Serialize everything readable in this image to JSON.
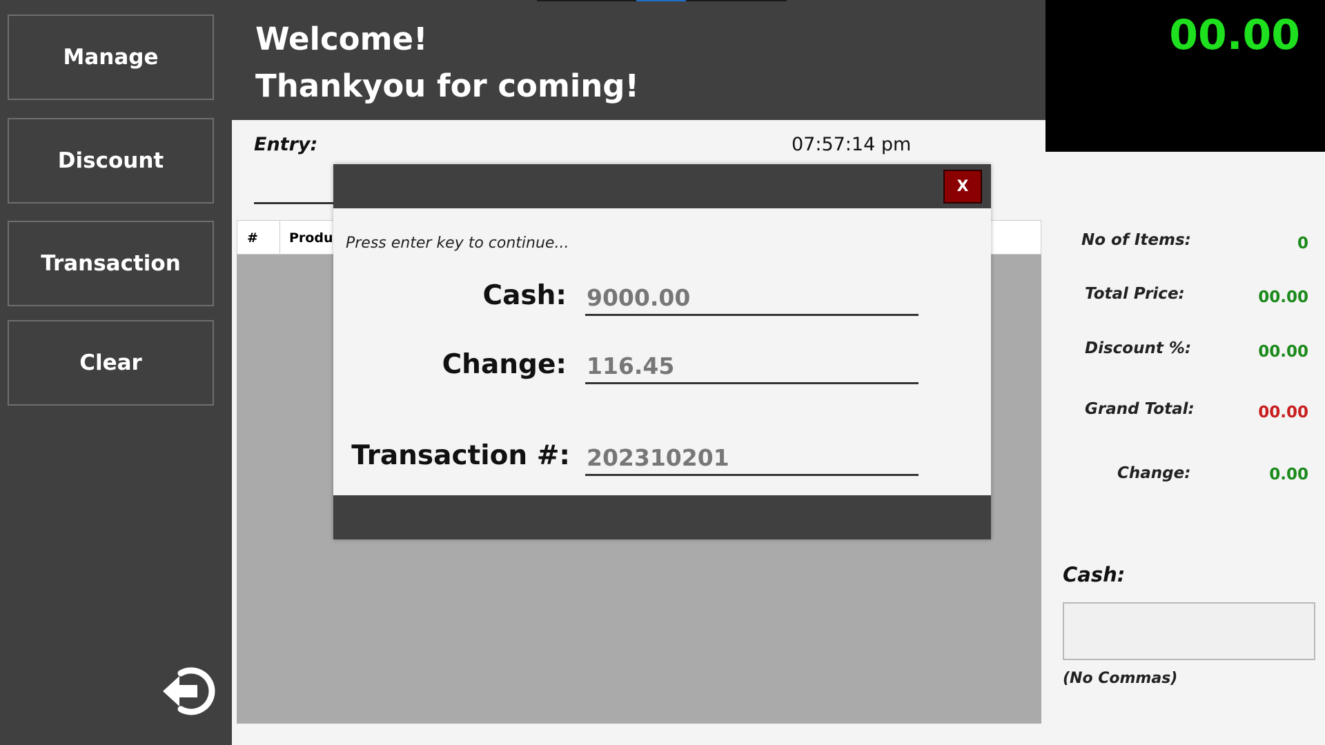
{
  "sidebar": {
    "buttons": [
      {
        "label": "Manage"
      },
      {
        "label": "Discount"
      },
      {
        "label": "Transaction"
      },
      {
        "label": "Clear"
      }
    ],
    "logout_icon": "logout-arrow-icon"
  },
  "header": {
    "line1": "Welcome!",
    "line2": "Thankyou for coming!"
  },
  "display": {
    "amount": "00.00",
    "color": "#1ee01e"
  },
  "entry": {
    "label": "Entry:",
    "time": "07:57:14 pm"
  },
  "grid": {
    "columns": [
      "#",
      "Produ"
    ]
  },
  "summary": {
    "items": [
      {
        "label": "No of Items:",
        "value": "0",
        "color": "#1a8a1a"
      },
      {
        "label": "Total Price:",
        "value": "00.00",
        "color": "#1a8a1a"
      },
      {
        "label": "Discount %:",
        "value": "00.00",
        "color": "#1a8a1a"
      },
      {
        "label": "Grand Total:",
        "value": "00.00",
        "color": "#c81e1e"
      },
      {
        "label": "Change:",
        "value": "0.00",
        "color": "#1a8a1a"
      }
    ],
    "cash_label": "Cash:",
    "cash_value": "",
    "cash_note": "(No Commas)"
  },
  "modal": {
    "close_label": "X",
    "hint": "Press enter key to continue...",
    "cash_label": "Cash:",
    "cash_value": "9000.00",
    "change_label": "Change:",
    "change_value": "116.45",
    "transaction_label": "Transaction #:",
    "transaction_value": "202310201"
  }
}
